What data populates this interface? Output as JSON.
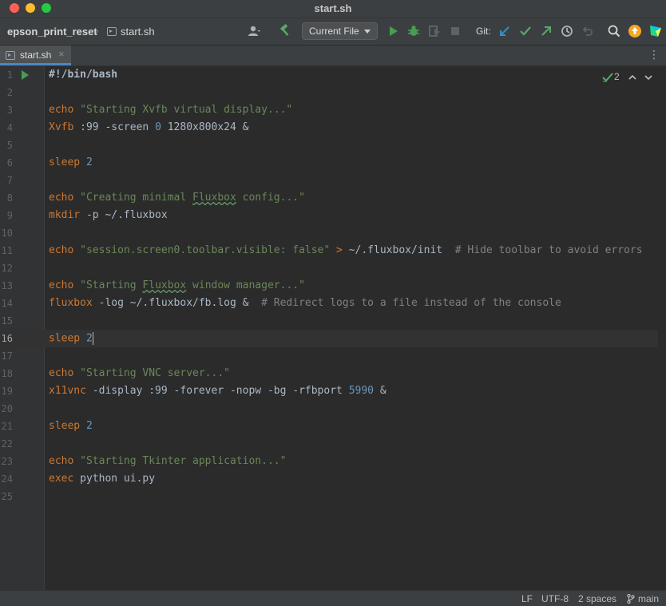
{
  "window": {
    "title": "start.sh"
  },
  "navbar": {
    "project": "epson_print_reset",
    "file": "start.sh",
    "run_config": "Current File",
    "git_label": "Git:"
  },
  "tabs": [
    {
      "label": "start.sh",
      "close": "×"
    }
  ],
  "editor": {
    "inspection_count": "2",
    "current_line": 16,
    "lines": [
      {
        "num": "1",
        "tokens": [
          {
            "t": "#!/bin/bash",
            "c": "shebang"
          }
        ]
      },
      {
        "num": "2",
        "tokens": []
      },
      {
        "num": "3",
        "tokens": [
          {
            "t": "echo",
            "c": "kw"
          },
          {
            "t": " ",
            "c": "plain"
          },
          {
            "t": "\"Starting Xvfb virtual display...\"",
            "c": "str"
          }
        ]
      },
      {
        "num": "4",
        "tokens": [
          {
            "t": "Xvfb",
            "c": "kw"
          },
          {
            "t": " :99 -screen ",
            "c": "plain"
          },
          {
            "t": "0",
            "c": "num"
          },
          {
            "t": " 1280x800x24 &",
            "c": "plain"
          }
        ]
      },
      {
        "num": "5",
        "tokens": []
      },
      {
        "num": "6",
        "tokens": [
          {
            "t": "sleep",
            "c": "kw"
          },
          {
            "t": " ",
            "c": "plain"
          },
          {
            "t": "2",
            "c": "num"
          }
        ]
      },
      {
        "num": "7",
        "tokens": []
      },
      {
        "num": "8",
        "tokens": [
          {
            "t": "echo",
            "c": "kw"
          },
          {
            "t": " ",
            "c": "plain"
          },
          {
            "t": "\"Creating minimal ",
            "c": "str"
          },
          {
            "t": "Fluxbox",
            "c": "str typo"
          },
          {
            "t": " config...\"",
            "c": "str"
          }
        ]
      },
      {
        "num": "9",
        "tokens": [
          {
            "t": "mkdir",
            "c": "kw"
          },
          {
            "t": " -p ~/.fluxbox",
            "c": "plain"
          }
        ]
      },
      {
        "num": "10",
        "tokens": []
      },
      {
        "num": "11",
        "tokens": [
          {
            "t": "echo",
            "c": "kw"
          },
          {
            "t": " ",
            "c": "plain"
          },
          {
            "t": "\"session.screen0.toolbar.visible: false\"",
            "c": "str"
          },
          {
            "t": " ",
            "c": "plain"
          },
          {
            "t": ">",
            "c": "kw"
          },
          {
            "t": " ~/.fluxbox/init  ",
            "c": "plain"
          },
          {
            "t": "# Hide toolbar to avoid errors",
            "c": "cmt"
          }
        ]
      },
      {
        "num": "12",
        "tokens": []
      },
      {
        "num": "13",
        "tokens": [
          {
            "t": "echo",
            "c": "kw"
          },
          {
            "t": " ",
            "c": "plain"
          },
          {
            "t": "\"Starting ",
            "c": "str"
          },
          {
            "t": "Fluxbox",
            "c": "str typo"
          },
          {
            "t": " window manager...\"",
            "c": "str"
          }
        ]
      },
      {
        "num": "14",
        "tokens": [
          {
            "t": "fluxbox",
            "c": "kw"
          },
          {
            "t": " -log ~/.fluxbox/fb.log &  ",
            "c": "plain"
          },
          {
            "t": "# Redirect logs to a file instead of the console",
            "c": "cmt"
          }
        ]
      },
      {
        "num": "15",
        "tokens": []
      },
      {
        "num": "16",
        "tokens": [
          {
            "t": "sleep",
            "c": "kw"
          },
          {
            "t": " ",
            "c": "plain"
          },
          {
            "t": "2",
            "c": "num"
          }
        ]
      },
      {
        "num": "17",
        "tokens": []
      },
      {
        "num": "18",
        "tokens": [
          {
            "t": "echo",
            "c": "kw"
          },
          {
            "t": " ",
            "c": "plain"
          },
          {
            "t": "\"Starting VNC server...\"",
            "c": "str"
          }
        ]
      },
      {
        "num": "19",
        "tokens": [
          {
            "t": "x11vnc",
            "c": "kw"
          },
          {
            "t": " -display :99 -forever -nopw -bg -rfbport ",
            "c": "plain"
          },
          {
            "t": "5990",
            "c": "num"
          },
          {
            "t": " &",
            "c": "plain"
          }
        ]
      },
      {
        "num": "20",
        "tokens": []
      },
      {
        "num": "21",
        "tokens": [
          {
            "t": "sleep",
            "c": "kw"
          },
          {
            "t": " ",
            "c": "plain"
          },
          {
            "t": "2",
            "c": "num"
          }
        ]
      },
      {
        "num": "22",
        "tokens": []
      },
      {
        "num": "23",
        "tokens": [
          {
            "t": "echo",
            "c": "kw"
          },
          {
            "t": " ",
            "c": "plain"
          },
          {
            "t": "\"Starting Tkinter application...\"",
            "c": "str"
          }
        ]
      },
      {
        "num": "24",
        "tokens": [
          {
            "t": "exec",
            "c": "kw"
          },
          {
            "t": " python ui.py",
            "c": "plain"
          }
        ]
      },
      {
        "num": "25",
        "tokens": []
      }
    ]
  },
  "statusbar": {
    "line_ending": "LF",
    "encoding": "UTF-8",
    "indent": "2 spaces",
    "branch": "main"
  },
  "icons": {
    "user": "user-icon",
    "build": "hammer-icon",
    "run": "run-icon",
    "debug": "debug-icon",
    "coverage": "coverage-icon",
    "stop": "stop-icon",
    "git_update": "git-update-icon",
    "git_commit": "git-commit-icon",
    "git_push": "git-push-icon",
    "history": "history-icon",
    "rollback": "rollback-icon",
    "search": "search-icon",
    "updates": "updates-icon",
    "jetbrains": "jetbrains-logo-icon"
  },
  "colors": {
    "keyword": "#cc7832",
    "string": "#6a8759",
    "number": "#6897bb",
    "comment": "#808080",
    "accent": "#4a88c7"
  }
}
